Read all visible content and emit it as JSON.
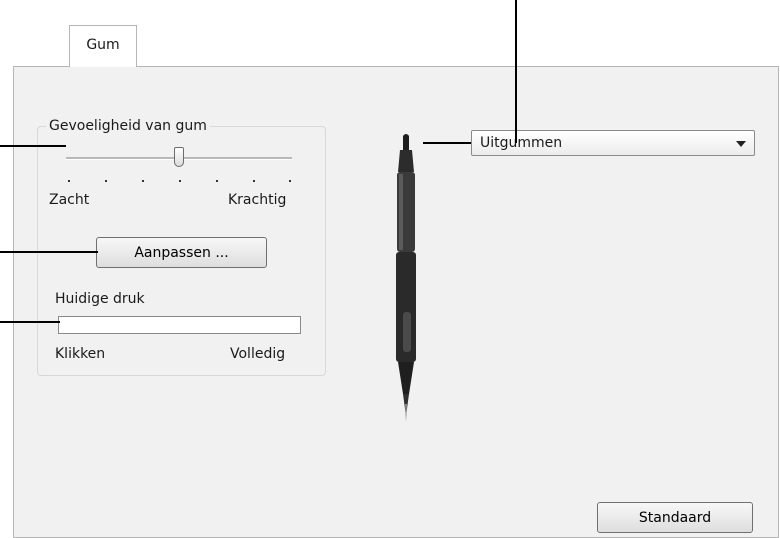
{
  "tab": {
    "label": "Gum"
  },
  "sensitivity": {
    "title": "Gevoeligheid van gum",
    "min_label": "Zacht",
    "max_label": "Krachtig",
    "level_fraction": 0.5,
    "steps": 7
  },
  "customize_button": {
    "label": "Aanpassen ..."
  },
  "pressure": {
    "label": "Huidige druk",
    "min_label": "Klikken",
    "max_label": "Volledig",
    "fill_fraction": 0
  },
  "eraser_function": {
    "selected": "Uitgummen"
  },
  "default_button": {
    "label": "Standaard"
  },
  "pen_icon": "pen-icon",
  "colors": {
    "panel": "#f1f1f1",
    "border": "#b6b6b6",
    "callout": "#000000"
  }
}
